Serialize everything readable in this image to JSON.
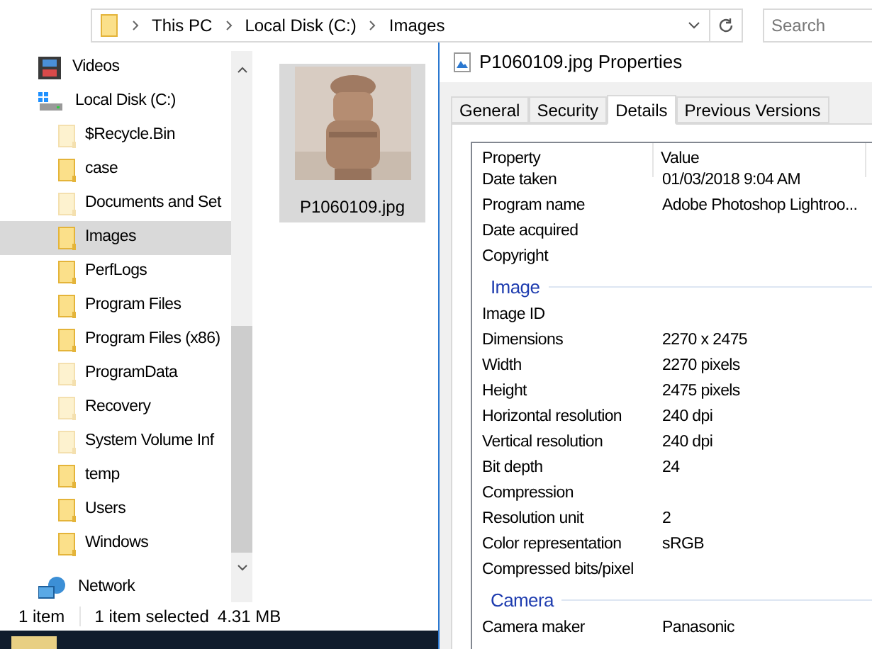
{
  "address_bar": {
    "crumbs": [
      "This PC",
      "Local Disk (C:)",
      "Images"
    ]
  },
  "search": {
    "placeholder": "Search"
  },
  "navigation": [
    {
      "kind": "videos",
      "label": "Videos",
      "selected": false
    },
    {
      "kind": "drive",
      "label": "Local Disk (C:)",
      "selected": false
    },
    {
      "kind": "folder",
      "label": "$Recycle.Bin",
      "hidden": true,
      "selected": false
    },
    {
      "kind": "folder",
      "label": "case",
      "hidden": false,
      "selected": false
    },
    {
      "kind": "shortcut",
      "label": "Documents and Set",
      "hidden": true,
      "selected": false
    },
    {
      "kind": "folder",
      "label": "Images",
      "hidden": false,
      "selected": true
    },
    {
      "kind": "folder",
      "label": "PerfLogs",
      "hidden": false,
      "selected": false
    },
    {
      "kind": "folder",
      "label": "Program Files",
      "hidden": false,
      "selected": false
    },
    {
      "kind": "folder",
      "label": "Program Files (x86)",
      "hidden": false,
      "selected": false
    },
    {
      "kind": "folder",
      "label": "ProgramData",
      "hidden": true,
      "selected": false
    },
    {
      "kind": "folder",
      "label": "Recovery",
      "hidden": true,
      "selected": false
    },
    {
      "kind": "folder",
      "label": "System Volume Inf",
      "hidden": true,
      "selected": false
    },
    {
      "kind": "folder",
      "label": "temp",
      "hidden": false,
      "selected": false
    },
    {
      "kind": "folder",
      "label": "Users",
      "hidden": false,
      "selected": false
    },
    {
      "kind": "folder",
      "label": "Windows",
      "hidden": false,
      "selected": false
    },
    {
      "kind": "network",
      "label": "Network",
      "selected": false
    }
  ],
  "files": [
    {
      "name": "P1060109.jpg",
      "kind": "picture",
      "selected": true
    }
  ],
  "status_bar": {
    "count": "1 item",
    "selection": "1 item selected",
    "size": "4.31 MB"
  },
  "dialog": {
    "title": "P1060109.jpg Properties",
    "tabs": [
      {
        "label": "General",
        "selected": false
      },
      {
        "label": "Security",
        "selected": false
      },
      {
        "label": "Details",
        "selected": true
      },
      {
        "label": "Previous Versions",
        "selected": false
      }
    ],
    "columns": [
      "Property",
      "Value"
    ],
    "rows": [
      {
        "kind": "row",
        "property": "Date taken",
        "value": "01/03/2018 9:04 AM"
      },
      {
        "kind": "row",
        "property": "Program name",
        "value": "Adobe Photoshop Lightroo..."
      },
      {
        "kind": "row",
        "property": "Date acquired"
      },
      {
        "kind": "row",
        "property": "Copyright"
      },
      {
        "kind": "section",
        "property": "Image"
      },
      {
        "kind": "row",
        "property": "Image ID"
      },
      {
        "kind": "row",
        "property": "Dimensions",
        "value": "2270 x 2475"
      },
      {
        "kind": "row",
        "property": "Width",
        "value": "2270 pixels"
      },
      {
        "kind": "row",
        "property": "Height",
        "value": "2475 pixels"
      },
      {
        "kind": "row",
        "property": "Horizontal resolution",
        "value": "240 dpi"
      },
      {
        "kind": "row",
        "property": "Vertical resolution",
        "value": "240 dpi"
      },
      {
        "kind": "row",
        "property": "Bit depth",
        "value": "24"
      },
      {
        "kind": "row",
        "property": "Compression"
      },
      {
        "kind": "row",
        "property": "Resolution unit",
        "value": "2"
      },
      {
        "kind": "row",
        "property": "Color representation",
        "value": "sRGB"
      },
      {
        "kind": "row",
        "property": "Compressed bits/pixel"
      },
      {
        "kind": "section",
        "property": "Camera"
      },
      {
        "kind": "row",
        "property": "Camera maker",
        "value": "Panasonic"
      }
    ]
  }
}
